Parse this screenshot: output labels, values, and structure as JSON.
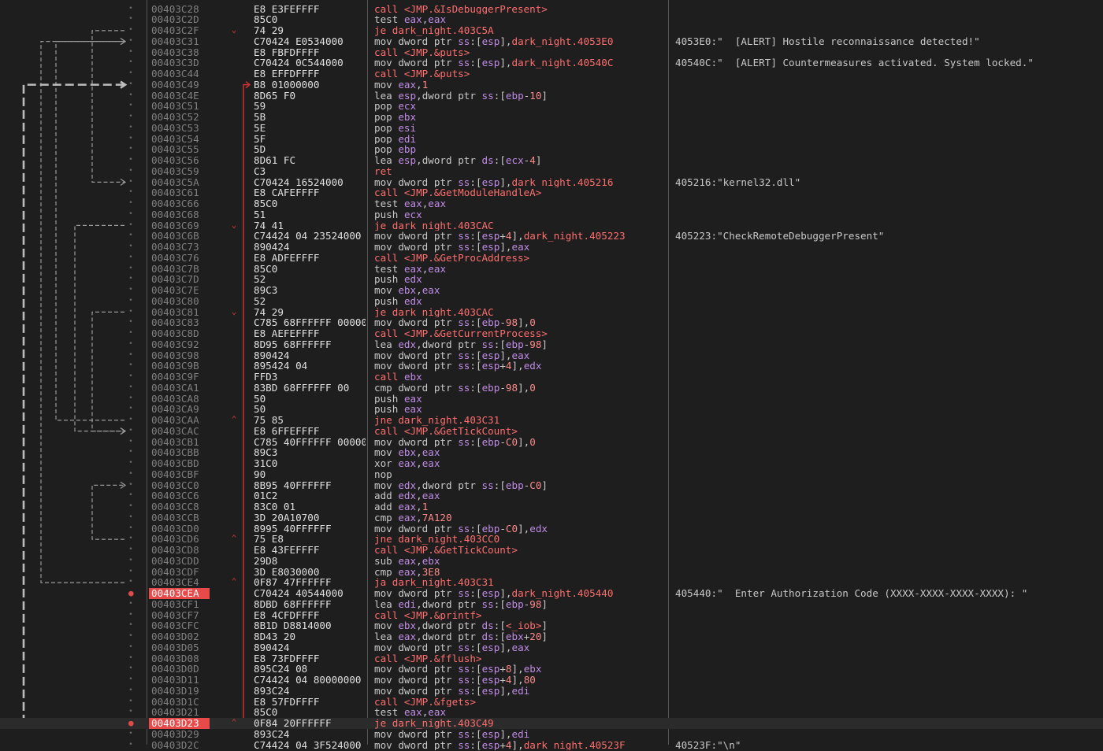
{
  "colors": {
    "background": "#1e1e1e",
    "address": "#808080",
    "breakpoint": "#e84a4a",
    "call": "#ff6e6e",
    "register": "#c08ce6",
    "jump_line": "#c83232",
    "guide_line": "#9a9a9a"
  },
  "rows": [
    {
      "addr": "00403C28",
      "bytes": "E8 E3FEFFFF",
      "instr": "call <JMP.&IsDebuggerPresent>",
      "comment": "",
      "arrow": "",
      "bp": false
    },
    {
      "addr": "00403C2D",
      "bytes": "85C0",
      "instr": "test eax,eax",
      "comment": "",
      "arrow": "",
      "bp": false
    },
    {
      "addr": "00403C2F",
      "bytes": "74 29",
      "instr": "je dark_night.403C5A",
      "comment": "",
      "arrow": "down",
      "bp": false
    },
    {
      "addr": "00403C31",
      "bytes": "C70424 E0534000",
      "instr": "mov dword ptr ss:[esp],dark_night.4053E0",
      "comment": "4053E0:\"  [ALERT] Hostile reconnaissance detected!\"",
      "arrow": "",
      "bp": false
    },
    {
      "addr": "00403C38",
      "bytes": "E8 FBFDFFFF",
      "instr": "call <JMP.&puts>",
      "comment": "",
      "arrow": "",
      "bp": false
    },
    {
      "addr": "00403C3D",
      "bytes": "C70424 0C544000",
      "instr": "mov dword ptr ss:[esp],dark_night.40540C",
      "comment": "40540C:\"  [ALERT] Countermeasures activated. System locked.\"",
      "arrow": "",
      "bp": false
    },
    {
      "addr": "00403C44",
      "bytes": "E8 EFFDFFFF",
      "instr": "call <JMP.&puts>",
      "comment": "",
      "arrow": "",
      "bp": false
    },
    {
      "addr": "00403C49",
      "bytes": "B8 01000000",
      "instr": "mov eax,1",
      "comment": "",
      "arrow": "target",
      "bp": false
    },
    {
      "addr": "00403C4E",
      "bytes": "8D65 F0",
      "instr": "lea esp,dword ptr ss:[ebp-10]",
      "comment": "",
      "arrow": "",
      "bp": false
    },
    {
      "addr": "00403C51",
      "bytes": "59",
      "instr": "pop ecx",
      "comment": "",
      "arrow": "",
      "bp": false
    },
    {
      "addr": "00403C52",
      "bytes": "5B",
      "instr": "pop ebx",
      "comment": "",
      "arrow": "",
      "bp": false
    },
    {
      "addr": "00403C53",
      "bytes": "5E",
      "instr": "pop esi",
      "comment": "",
      "arrow": "",
      "bp": false
    },
    {
      "addr": "00403C54",
      "bytes": "5F",
      "instr": "pop edi",
      "comment": "",
      "arrow": "",
      "bp": false
    },
    {
      "addr": "00403C55",
      "bytes": "5D",
      "instr": "pop ebp",
      "comment": "",
      "arrow": "",
      "bp": false
    },
    {
      "addr": "00403C56",
      "bytes": "8D61 FC",
      "instr": "lea esp,dword ptr ds:[ecx-4]",
      "comment": "",
      "arrow": "",
      "bp": false
    },
    {
      "addr": "00403C59",
      "bytes": "C3",
      "instr": "ret",
      "comment": "",
      "arrow": "",
      "bp": false
    },
    {
      "addr": "00403C5A",
      "bytes": "C70424 16524000",
      "instr": "mov dword ptr ss:[esp],dark_night.405216",
      "comment": "405216:\"kernel32.dll\"",
      "arrow": "",
      "bp": false
    },
    {
      "addr": "00403C61",
      "bytes": "E8 CAFEFFFF",
      "instr": "call <JMP.&GetModuleHandleA>",
      "comment": "",
      "arrow": "",
      "bp": false
    },
    {
      "addr": "00403C66",
      "bytes": "85C0",
      "instr": "test eax,eax",
      "comment": "",
      "arrow": "",
      "bp": false
    },
    {
      "addr": "00403C68",
      "bytes": "51",
      "instr": "push ecx",
      "comment": "",
      "arrow": "",
      "bp": false
    },
    {
      "addr": "00403C69",
      "bytes": "74 41",
      "instr": "je dark_night.403CAC",
      "comment": "",
      "arrow": "down",
      "bp": false
    },
    {
      "addr": "00403C6B",
      "bytes": "C74424 04 23524000",
      "instr": "mov dword ptr ss:[esp+4],dark_night.405223",
      "comment": "405223:\"CheckRemoteDebuggerPresent\"",
      "arrow": "",
      "bp": false
    },
    {
      "addr": "00403C73",
      "bytes": "890424",
      "instr": "mov dword ptr ss:[esp],eax",
      "comment": "",
      "arrow": "",
      "bp": false
    },
    {
      "addr": "00403C76",
      "bytes": "E8 ADFEFFFF",
      "instr": "call <JMP.&GetProcAddress>",
      "comment": "",
      "arrow": "",
      "bp": false
    },
    {
      "addr": "00403C7B",
      "bytes": "85C0",
      "instr": "test eax,eax",
      "comment": "",
      "arrow": "",
      "bp": false
    },
    {
      "addr": "00403C7D",
      "bytes": "52",
      "instr": "push edx",
      "comment": "",
      "arrow": "",
      "bp": false
    },
    {
      "addr": "00403C7E",
      "bytes": "89C3",
      "instr": "mov ebx,eax",
      "comment": "",
      "arrow": "",
      "bp": false
    },
    {
      "addr": "00403C80",
      "bytes": "52",
      "instr": "push edx",
      "comment": "",
      "arrow": "",
      "bp": false
    },
    {
      "addr": "00403C81",
      "bytes": "74 29",
      "instr": "je dark_night.403CAC",
      "comment": "",
      "arrow": "down",
      "bp": false
    },
    {
      "addr": "00403C83",
      "bytes": "C785 68FFFFFF 00000",
      "instr": "mov dword ptr ss:[ebp-98],0",
      "comment": "",
      "arrow": "",
      "bp": false
    },
    {
      "addr": "00403C8D",
      "bytes": "E8 AEFEFFFF",
      "instr": "call <JMP.&GetCurrentProcess>",
      "comment": "",
      "arrow": "",
      "bp": false
    },
    {
      "addr": "00403C92",
      "bytes": "8D95 68FFFFFF",
      "instr": "lea edx,dword ptr ss:[ebp-98]",
      "comment": "",
      "arrow": "",
      "bp": false
    },
    {
      "addr": "00403C98",
      "bytes": "890424",
      "instr": "mov dword ptr ss:[esp],eax",
      "comment": "",
      "arrow": "",
      "bp": false
    },
    {
      "addr": "00403C9B",
      "bytes": "895424 04",
      "instr": "mov dword ptr ss:[esp+4],edx",
      "comment": "",
      "arrow": "",
      "bp": false
    },
    {
      "addr": "00403C9F",
      "bytes": "FFD3",
      "instr": "call ebx",
      "comment": "",
      "arrow": "",
      "bp": false
    },
    {
      "addr": "00403CA1",
      "bytes": "83BD 68FFFFFF 00",
      "instr": "cmp dword ptr ss:[ebp-98],0",
      "comment": "",
      "arrow": "",
      "bp": false
    },
    {
      "addr": "00403CA8",
      "bytes": "50",
      "instr": "push eax",
      "comment": "",
      "arrow": "",
      "bp": false
    },
    {
      "addr": "00403CA9",
      "bytes": "50",
      "instr": "push eax",
      "comment": "",
      "arrow": "",
      "bp": false
    },
    {
      "addr": "00403CAA",
      "bytes": "75 85",
      "instr": "jne dark_night.403C31",
      "comment": "",
      "arrow": "up",
      "bp": false
    },
    {
      "addr": "00403CAC",
      "bytes": "E8 6FFEFFFF",
      "instr": "call <JMP.&GetTickCount>",
      "comment": "",
      "arrow": "",
      "bp": false
    },
    {
      "addr": "00403CB1",
      "bytes": "C785 40FFFFFF 00000",
      "instr": "mov dword ptr ss:[ebp-C0],0",
      "comment": "",
      "arrow": "",
      "bp": false
    },
    {
      "addr": "00403CBB",
      "bytes": "89C3",
      "instr": "mov ebx,eax",
      "comment": "",
      "arrow": "",
      "bp": false
    },
    {
      "addr": "00403CBD",
      "bytes": "31C0",
      "instr": "xor eax,eax",
      "comment": "",
      "arrow": "",
      "bp": false
    },
    {
      "addr": "00403CBF",
      "bytes": "90",
      "instr": "nop",
      "comment": "",
      "arrow": "",
      "bp": false
    },
    {
      "addr": "00403CC0",
      "bytes": "8B95 40FFFFFF",
      "instr": "mov edx,dword ptr ss:[ebp-C0]",
      "comment": "",
      "arrow": "",
      "bp": false
    },
    {
      "addr": "00403CC6",
      "bytes": "01C2",
      "instr": "add edx,eax",
      "comment": "",
      "arrow": "",
      "bp": false
    },
    {
      "addr": "00403CC8",
      "bytes": "83C0 01",
      "instr": "add eax,1",
      "comment": "",
      "arrow": "",
      "bp": false
    },
    {
      "addr": "00403CCB",
      "bytes": "3D 20A10700",
      "instr": "cmp eax,7A120",
      "comment": "",
      "arrow": "",
      "bp": false
    },
    {
      "addr": "00403CD0",
      "bytes": "8995 40FFFFFF",
      "instr": "mov dword ptr ss:[ebp-C0],edx",
      "comment": "",
      "arrow": "",
      "bp": false
    },
    {
      "addr": "00403CD6",
      "bytes": "75 E8",
      "instr": "jne dark_night.403CC0",
      "comment": "",
      "arrow": "up",
      "bp": false
    },
    {
      "addr": "00403CD8",
      "bytes": "E8 43FEFFFF",
      "instr": "call <JMP.&GetTickCount>",
      "comment": "",
      "arrow": "",
      "bp": false
    },
    {
      "addr": "00403CDD",
      "bytes": "29D8",
      "instr": "sub eax,ebx",
      "comment": "",
      "arrow": "",
      "bp": false
    },
    {
      "addr": "00403CDF",
      "bytes": "3D E8030000",
      "instr": "cmp eax,3E8",
      "comment": "",
      "arrow": "",
      "bp": false
    },
    {
      "addr": "00403CE4",
      "bytes": "0F87 47FFFFFF",
      "instr": "ja dark_night.403C31",
      "comment": "",
      "arrow": "up",
      "bp": false
    },
    {
      "addr": "00403CEA",
      "bytes": "C70424 40544000",
      "instr": "mov dword ptr ss:[esp],dark_night.405440",
      "comment": "405440:\"  Enter Authorization Code (XXXX-XXXX-XXXX-XXXX): \"",
      "arrow": "",
      "bp": true
    },
    {
      "addr": "00403CF1",
      "bytes": "8DBD 68FFFFFF",
      "instr": "lea edi,dword ptr ss:[ebp-98]",
      "comment": "",
      "arrow": "",
      "bp": false
    },
    {
      "addr": "00403CF7",
      "bytes": "E8 4CFDFFFF",
      "instr": "call <JMP.&printf>",
      "comment": "",
      "arrow": "",
      "bp": false
    },
    {
      "addr": "00403CFC",
      "bytes": "8B1D D8814000",
      "instr": "mov ebx,dword ptr ds:[<_iob>]",
      "comment": "",
      "arrow": "",
      "bp": false
    },
    {
      "addr": "00403D02",
      "bytes": "8D43 20",
      "instr": "lea eax,dword ptr ds:[ebx+20]",
      "comment": "",
      "arrow": "",
      "bp": false
    },
    {
      "addr": "00403D05",
      "bytes": "890424",
      "instr": "mov dword ptr ss:[esp],eax",
      "comment": "",
      "arrow": "",
      "bp": false
    },
    {
      "addr": "00403D08",
      "bytes": "E8 73FDFFFF",
      "instr": "call <JMP.&fflush>",
      "comment": "",
      "arrow": "",
      "bp": false
    },
    {
      "addr": "00403D0D",
      "bytes": "895C24 08",
      "instr": "mov dword ptr ss:[esp+8],ebx",
      "comment": "",
      "arrow": "",
      "bp": false
    },
    {
      "addr": "00403D11",
      "bytes": "C74424 04 80000000",
      "instr": "mov dword ptr ss:[esp+4],80",
      "comment": "",
      "arrow": "",
      "bp": false
    },
    {
      "addr": "00403D19",
      "bytes": "893C24",
      "instr": "mov dword ptr ss:[esp],edi",
      "comment": "",
      "arrow": "",
      "bp": false
    },
    {
      "addr": "00403D1C",
      "bytes": "E8 57FDFFFF",
      "instr": "call <JMP.&fgets>",
      "comment": "",
      "arrow": "",
      "bp": false
    },
    {
      "addr": "00403D21",
      "bytes": "85C0",
      "instr": "test eax,eax",
      "comment": "",
      "arrow": "",
      "bp": false
    },
    {
      "addr": "00403D23",
      "bytes": "0F84 20FFFFFF",
      "instr": "je dark_night.403C49",
      "comment": "",
      "arrow": "up",
      "bp": true
    },
    {
      "addr": "00403D29",
      "bytes": "893C24",
      "instr": "mov dword ptr ss:[esp],edi",
      "comment": "",
      "arrow": "",
      "bp": false
    },
    {
      "addr": "00403D2C",
      "bytes": "C74424 04 3F524000",
      "instr": "mov dword ptr ss:[esp+4],dark_night.40523F",
      "comment": "40523F:\"\\n\"",
      "arrow": "",
      "bp": false
    }
  ]
}
